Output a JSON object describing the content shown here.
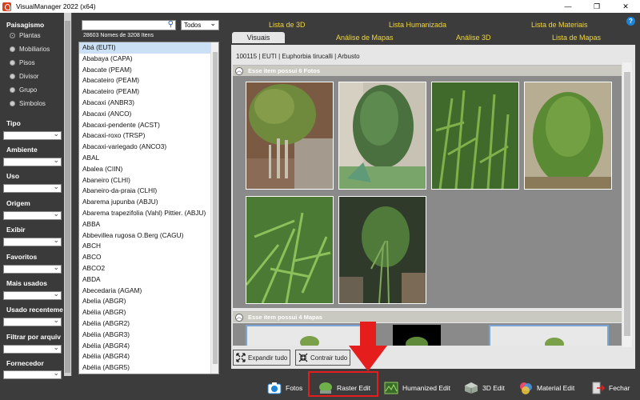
{
  "window": {
    "title": "VisualManager 2022 (x64)",
    "controls": [
      "—",
      "❐",
      "✕"
    ]
  },
  "sidebar": {
    "paisagismo_label": "Paisagismo",
    "radios": [
      {
        "label": "Plantas",
        "selected": true
      },
      {
        "label": "Mobiliarios",
        "selected": false
      },
      {
        "label": "Pisos",
        "selected": false
      },
      {
        "label": "Divisor",
        "selected": false
      },
      {
        "label": "Grupo",
        "selected": false
      },
      {
        "label": "Simbolos",
        "selected": false
      }
    ],
    "filters": [
      "Tipo",
      "Ambiente",
      "Uso",
      "Origem",
      "Exibir",
      "Favoritos",
      "Mais usados",
      "Usado recenteme",
      "Filtrar por arquiv",
      "Fornecedor"
    ]
  },
  "list": {
    "search_placeholder": "",
    "category_value": "Todos",
    "count_text": "28603 Nomes de 3208 Itens",
    "names": [
      "Abá (EUTI)",
      "Ababaya (CAPA)",
      "Abacate (PEAM)",
      "Abacateiro (PEAM)",
      "Abacateiro (PEAM)",
      "Abacaxi (ANBR3)",
      "Abacaxi (ANCO)",
      "Abacaxi-pendente (ACST)",
      "Abacaxi-roxo (TRSP)",
      "Abacaxi-variegado (ANCO3)",
      "ABAL",
      "Abalea (CIIN)",
      "Abaneiro (CLHI)",
      "Abaneiro-da-praia (CLHI)",
      "Abarema jupunba (ABJU)",
      "Abarema trapezifolia (Vahl) Pittier. (ABJU)",
      "ABBA",
      "Abbevillea rugosa O.Berg (CAGU)",
      "ABCH",
      "ABCO",
      "ABCO2",
      "ABDA",
      "Abecedaria (AGAM)",
      "Abelia (ABGR)",
      "Abélia (ABGR)",
      "Abélia (ABGR2)",
      "Abélia (ABGR3)",
      "Abélia (ABGR4)",
      "Abélia (ABGR4)",
      "Abélia (ABGR5)"
    ]
  },
  "tabs": {
    "row1": [
      "Lista de 3D",
      "Lista Humanizada",
      "Lista de Materiais"
    ],
    "row2": [
      "Visuais",
      "Análise de Mapas",
      "Análise 3D",
      "Lista de Mapas"
    ],
    "active": "Visuais"
  },
  "content": {
    "item_path": "100115 | EUTI | Euphorbia tirucalli | Arbusto",
    "photos_header": "Esse item possui  6 Fotos",
    "maps_header": "Esse item possui  4 Mapas",
    "expand_label": "Expandir tudo",
    "collapse_label": "Contrair tudo"
  },
  "toolbar": {
    "fotos": "Fotos",
    "raster_edit": "Raster Edit",
    "humanized_edit": "Humanized Edit",
    "edit_3d": "3D Edit",
    "material_edit": "Material Edit",
    "fechar": "Fechar"
  },
  "colors": {
    "tab_text": "#f0d63c",
    "highlight": "#e51d1d",
    "panel_bg": "#3c3c3c"
  }
}
